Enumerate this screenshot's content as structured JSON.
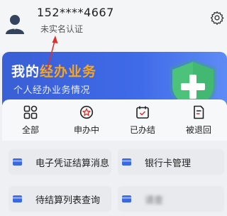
{
  "user": {
    "phone": "152****4667",
    "verify_status": "未实名认证"
  },
  "banner": {
    "title_part1": "我的",
    "title_part2": "经办业务",
    "subtitle": "个人经办业务情况",
    "accent_color": "#f5a623",
    "shield_color": "#4cc27a"
  },
  "status_tabs": [
    {
      "label": "全部",
      "icon": "grid-icon"
    },
    {
      "label": "申办中",
      "icon": "star-circle-icon"
    },
    {
      "label": "已办结",
      "icon": "calendar-check-icon"
    },
    {
      "label": "被退回",
      "icon": "document-return-icon"
    }
  ],
  "services": [
    {
      "label": "电子凭证结算消息"
    },
    {
      "label": "银行卡管理"
    },
    {
      "label": "待结算列表查询"
    },
    {
      "label": "请查"
    }
  ],
  "icons": {
    "settings": "gear-icon",
    "avatar": "avatar-icon",
    "service_card": "card-icon"
  },
  "annotation": {
    "color": "#d6332e"
  }
}
